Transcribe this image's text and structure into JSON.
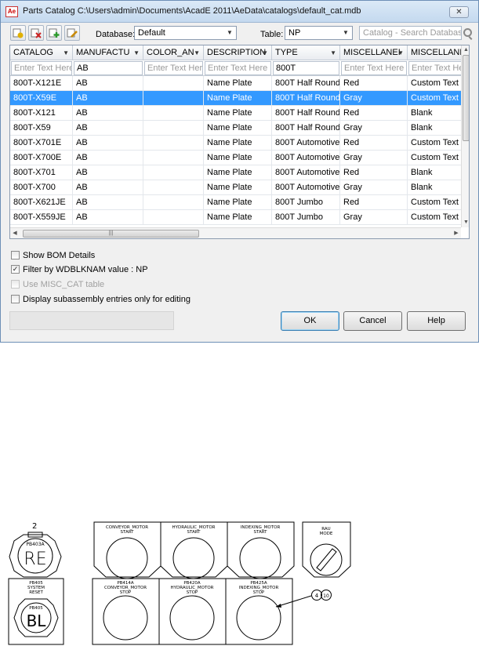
{
  "window": {
    "title": "Parts Catalog C:\\Users\\admin\\Documents\\AcadE 2011\\AeData\\catalogs\\default_cat.mdb",
    "close_glyph": "✕",
    "app_icon_text": "Ae"
  },
  "toolbar": {
    "buttons": [
      {
        "name": "catalog-add-button",
        "icon": "add-record-icon",
        "color": "#d9a300"
      },
      {
        "name": "catalog-delete-button",
        "icon": "delete-record-icon",
        "color": "#cc2222"
      },
      {
        "name": "catalog-copy-button",
        "icon": "copy-record-icon",
        "color": "#2d9a2d"
      },
      {
        "name": "catalog-edit-button",
        "icon": "edit-record-icon",
        "color": "#c98a00"
      }
    ],
    "database_label": "Database:",
    "database_value": "Default",
    "table_label": "Table:",
    "table_value": "NP",
    "search_placeholder": "Catalog - Search Database"
  },
  "grid": {
    "columns": [
      "CATALOG",
      "MANUFACTU",
      "COLOR_AN",
      "DESCRIPTION",
      "TYPE",
      "MISCELLANEI",
      "MISCELLANE"
    ],
    "filters": [
      "Enter Text Here",
      "AB",
      "Enter Text Here",
      "Enter Text Here",
      "800T",
      "Enter Text Here",
      "Enter Text Here"
    ],
    "rows": [
      [
        "800T-X121E",
        "AB",
        "",
        "Name Plate",
        "800T Half Round",
        "Red",
        "Custom Text"
      ],
      [
        "800T-X59E",
        "AB",
        "",
        "Name Plate",
        "800T Half Round",
        "Gray",
        "Custom Text"
      ],
      [
        "800T-X121",
        "AB",
        "",
        "Name Plate",
        "800T Half Round",
        "Red",
        "Blank"
      ],
      [
        "800T-X59",
        "AB",
        "",
        "Name Plate",
        "800T Half Round",
        "Gray",
        "Blank"
      ],
      [
        "800T-X701E",
        "AB",
        "",
        "Name Plate",
        "800T Automotive",
        "Red",
        "Custom Text"
      ],
      [
        "800T-X700E",
        "AB",
        "",
        "Name Plate",
        "800T Automotive",
        "Gray",
        "Custom Text"
      ],
      [
        "800T-X701",
        "AB",
        "",
        "Name Plate",
        "800T Automotive",
        "Red",
        "Blank"
      ],
      [
        "800T-X700",
        "AB",
        "",
        "Name Plate",
        "800T Automotive",
        "Gray",
        "Blank"
      ],
      [
        "800T-X621JE",
        "AB",
        "",
        "Name Plate",
        "800T Jumbo",
        "Red",
        "Custom Text"
      ],
      [
        "800T-X559JE",
        "AB",
        "",
        "Name Plate",
        "800T Jumbo",
        "Gray",
        "Custom Text"
      ]
    ],
    "selected_row": 1,
    "selection_color": "#3399ff"
  },
  "options": {
    "show_bom": {
      "label": "Show BOM Details",
      "checked": false,
      "enabled": true
    },
    "filter_wdblknam": {
      "label": "Filter by WDBLKNAM value : NP",
      "checked": true,
      "enabled": true
    },
    "use_misc_cat": {
      "label": "Use MISC_CAT table",
      "checked": false,
      "enabled": false
    },
    "subassembly": {
      "label": "Display subassembly entries only for editing",
      "checked": false,
      "enabled": true
    }
  },
  "buttons": {
    "ok": "OK",
    "cancel": "Cancel",
    "help": "Help"
  },
  "drawing": {
    "tag_number": "2",
    "top_row": [
      {
        "label": "PB403A",
        "big": "RE"
      },
      {
        "label": "CONVEYOR_MOTOR\nSTART"
      },
      {
        "label": "HYDRAULIC_MOTOR\nSTART"
      },
      {
        "label": "INDEXING_MOTOR\nSTART"
      },
      {
        "label": "RAU\nMODE"
      }
    ],
    "bottom_row": [
      {
        "label": "PB405\nSYSTEM\nRESET",
        "sub": "PB405",
        "big": "BL"
      },
      {
        "label": "PB414A\nCONVEYOR_MOTOR\nSTOP"
      },
      {
        "label": "PB420A\nHYDRAULIC_MOTOR\nSTOP"
      },
      {
        "label": "PB425A\nINDEXING_MOTOR\nSTOP"
      }
    ],
    "balloon_a": "4",
    "balloon_b": "10"
  }
}
